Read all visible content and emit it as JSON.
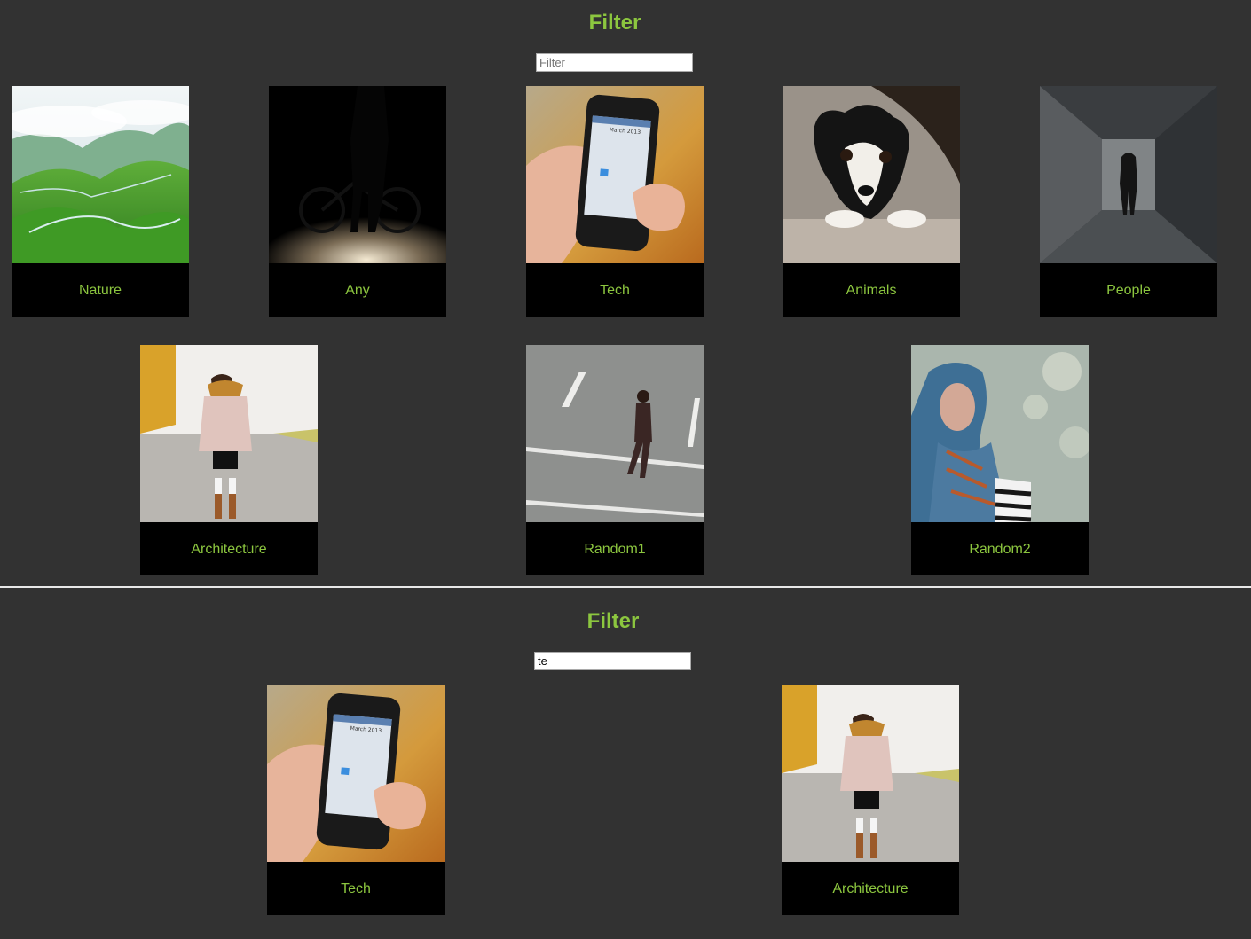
{
  "top": {
    "title": "Filter",
    "filter_placeholder": "Filter",
    "filter_value": "",
    "cards": [
      {
        "label": "Nature",
        "image": "nature-photo"
      },
      {
        "label": "Any",
        "image": "bicycle-silhouette-photo"
      },
      {
        "label": "Tech",
        "image": "smartphone-calendar-photo"
      },
      {
        "label": "Animals",
        "image": "puppy-photo"
      },
      {
        "label": "People",
        "image": "person-in-corridor-photo"
      },
      {
        "label": "Architecture",
        "image": "woman-on-road-photo"
      },
      {
        "label": "Random1",
        "image": "man-crossing-street-photo"
      },
      {
        "label": "Random2",
        "image": "woman-in-scarf-photo"
      }
    ]
  },
  "bottom": {
    "title": "Filter",
    "filter_placeholder": "Filter",
    "filter_value": "te",
    "cards": [
      {
        "label": "Tech",
        "image": "smartphone-calendar-photo"
      },
      {
        "label": "Architecture",
        "image": "woman-on-road-photo"
      }
    ]
  },
  "colors": {
    "background": "#323232",
    "accent": "#8cc63f",
    "card": "#000000",
    "divider": "#e8e8e8"
  }
}
